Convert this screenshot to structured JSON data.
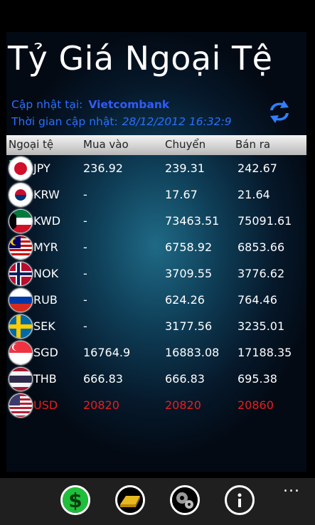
{
  "title": "Tỷ Giá Ngoại Tệ",
  "update": {
    "label": "Cập nhật tại:",
    "source": "Vietcombank"
  },
  "time": {
    "label": "Thời gian cập nhật:",
    "value": "28/12/2012 16:32:9"
  },
  "columns": [
    "Ngoại tệ",
    "Mua vào",
    "Chuyển",
    "Bán ra"
  ],
  "rates": [
    {
      "code": "JPY",
      "buy": "236.92",
      "transfer": "239.31",
      "sell": "242.67"
    },
    {
      "code": "KRW",
      "buy": "-",
      "transfer": "17.67",
      "sell": "21.64"
    },
    {
      "code": "KWD",
      "buy": "-",
      "transfer": "73463.51",
      "sell": "75091.61"
    },
    {
      "code": "MYR",
      "buy": "-",
      "transfer": "6758.92",
      "sell": "6853.66"
    },
    {
      "code": "NOK",
      "buy": "-",
      "transfer": "3709.55",
      "sell": "3776.62"
    },
    {
      "code": "RUB",
      "buy": "-",
      "transfer": "624.26",
      "sell": "764.46"
    },
    {
      "code": "SEK",
      "buy": "-",
      "transfer": "3177.56",
      "sell": "3235.01"
    },
    {
      "code": "SGD",
      "buy": "16764.9",
      "transfer": "16883.08",
      "sell": "17188.35"
    },
    {
      "code": "THB",
      "buy": "666.83",
      "transfer": "666.83",
      "sell": "695.38"
    },
    {
      "code": "USD",
      "buy": "20820",
      "transfer": "20820",
      "sell": "20860"
    }
  ],
  "appbar": {
    "buttons": [
      "dollar-icon",
      "gold-bar-icon",
      "settings-gears-icon",
      "info-icon"
    ],
    "more": "..."
  },
  "colors": {
    "link": "#2b6fff",
    "highlight": "#e02020",
    "dollar": "#1fbf3a",
    "gold": "#e8b820"
  }
}
